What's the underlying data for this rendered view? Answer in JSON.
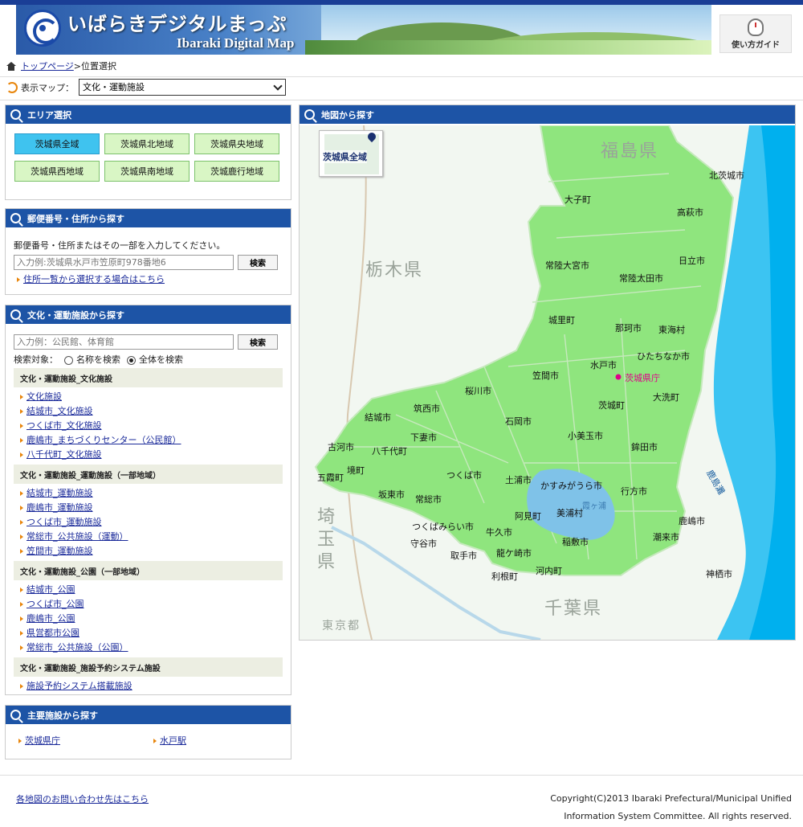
{
  "header": {
    "logo_jp": "いばらきデジタルまっぷ",
    "logo_en": "Ibaraki Digital Map",
    "guide_label": "使い方ガイド"
  },
  "breadcrumb": {
    "home": "トップページ",
    "separator": ">",
    "current": "位置選択"
  },
  "map_select": {
    "label": "表示マップ：",
    "value": "文化・運動施設"
  },
  "area_panel": {
    "title": "エリア選択",
    "buttons": [
      "茨城県全域",
      "茨城県北地域",
      "茨城県央地域",
      "茨城県西地域",
      "茨城県南地域",
      "茨城鹿行地域"
    ],
    "active_index": 0
  },
  "address_panel": {
    "title": "郵便番号・住所から探す",
    "instruction": "郵便番号・住所またはその一部を入力してください。",
    "placeholder": "入力例:茨城県水戸市笠原町978番地6",
    "search_button": "検索",
    "link": "住所一覧から選択する場合はこちら"
  },
  "facility_panel": {
    "title": "文化・運動施設から探す",
    "placeholder": "入力例：公民館、体育館",
    "search_button": "検索",
    "target_label": "検索対象：",
    "radio_name": "名称を検索",
    "radio_all": "全体を検索",
    "categories": [
      {
        "title": "文化・運動施設_文化施設",
        "links": [
          "文化施設",
          "結城市_文化施設",
          "つくば市_文化施設",
          "鹿嶋市_まちづくりセンター（公民館）",
          "八千代町_文化施設"
        ]
      },
      {
        "title": "文化・運動施設_運動施設（一部地域）",
        "links": [
          "結城市_運動施設",
          "鹿嶋市_運動施設",
          "つくば市_運動施設",
          "常総市_公共施設（運動）",
          "笠間市_運動施設"
        ]
      },
      {
        "title": "文化・運動施設_公園（一部地域）",
        "links": [
          "結城市_公園",
          "つくば市_公園",
          "鹿嶋市_公園",
          "県営都市公園",
          "常総市_公共施設（公園）"
        ]
      },
      {
        "title": "文化・運動施設_施設予約システム施設",
        "links": [
          "施設予約システム搭載施設"
        ]
      }
    ]
  },
  "major_panel": {
    "title": "主要施設から探す",
    "links": [
      "茨城県庁",
      "水戸駅"
    ]
  },
  "map_panel": {
    "title": "地図から探す",
    "overview_label": "茨城県全域",
    "prefectures": [
      "福島県",
      "栃木県",
      "埼玉県",
      "千葉県",
      "東京都"
    ],
    "cities": [
      "北茨城市",
      "大子町",
      "高萩市",
      "日立市",
      "常陸大宮市",
      "常陸太田市",
      "城里町",
      "那珂市",
      "東海村",
      "ひたちなか市",
      "水戸市",
      "笠間市",
      "桜川市",
      "筑西市",
      "結城市",
      "下妻市",
      "石岡市",
      "茨城町",
      "大洗町",
      "小美玉市",
      "鉾田市",
      "古河市",
      "八千代町",
      "境町",
      "五霞町",
      "坂東市",
      "常総市",
      "つくば市",
      "土浦市",
      "かすみがうら市",
      "行方市",
      "鹿嶋市",
      "阿見町",
      "美浦村",
      "つくばみらい市",
      "守谷市",
      "牛久市",
      "取手市",
      "龍ケ崎市",
      "稲敷市",
      "潮来市",
      "利根町",
      "河内町",
      "神栖市"
    ],
    "capital_label": "茨城県庁",
    "lake": "霞ヶ浦",
    "sea": "鹿島灘"
  },
  "footer": {
    "link": "各地図のお問い合わせ先はこちら",
    "copyright_1": "Copyright(C)2013 Ibaraki Prefectural/Municipal Unified",
    "copyright_2": "Information System Committee. All rights reserved."
  },
  "colors": {
    "accent": "#1d54a6",
    "area_btn": "#d9f6c5",
    "area_active": "#3fc3ef",
    "map_land": "#8fe57e",
    "sea": "#00b3f0"
  }
}
